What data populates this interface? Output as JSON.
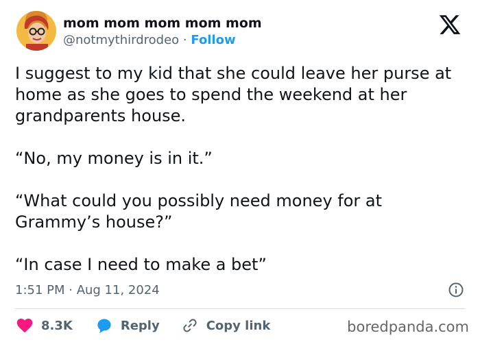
{
  "author": {
    "display_name": "mom mom mom mom mom",
    "handle": "@notmythirdrodeo",
    "separator": "·",
    "follow_label": "Follow"
  },
  "logo_icon": "x-logo-icon",
  "tweet": {
    "paragraphs": [
      "I suggest to my kid that she could leave her purse at home as she goes to spend the weekend at her grandparents house.",
      "“No, my money is in it.”",
      "“What could you possibly need money for at Grammy’s house?”",
      "“In case I need to make a bet”"
    ],
    "timestamp": "1:51 PM · Aug 11, 2024"
  },
  "actions": {
    "like_count": "8.3K",
    "reply_label": "Reply",
    "copy_link_label": "Copy link"
  },
  "watermark": "boredpanda.com",
  "colors": {
    "text": "#0f1419",
    "secondary_text": "#536471",
    "follow_blue": "#1d9bf0",
    "heart_pink": "#f91880",
    "reply_blue": "#1d9bf0",
    "divider": "#cfd9de",
    "avatar_bg": "#f4b942"
  }
}
